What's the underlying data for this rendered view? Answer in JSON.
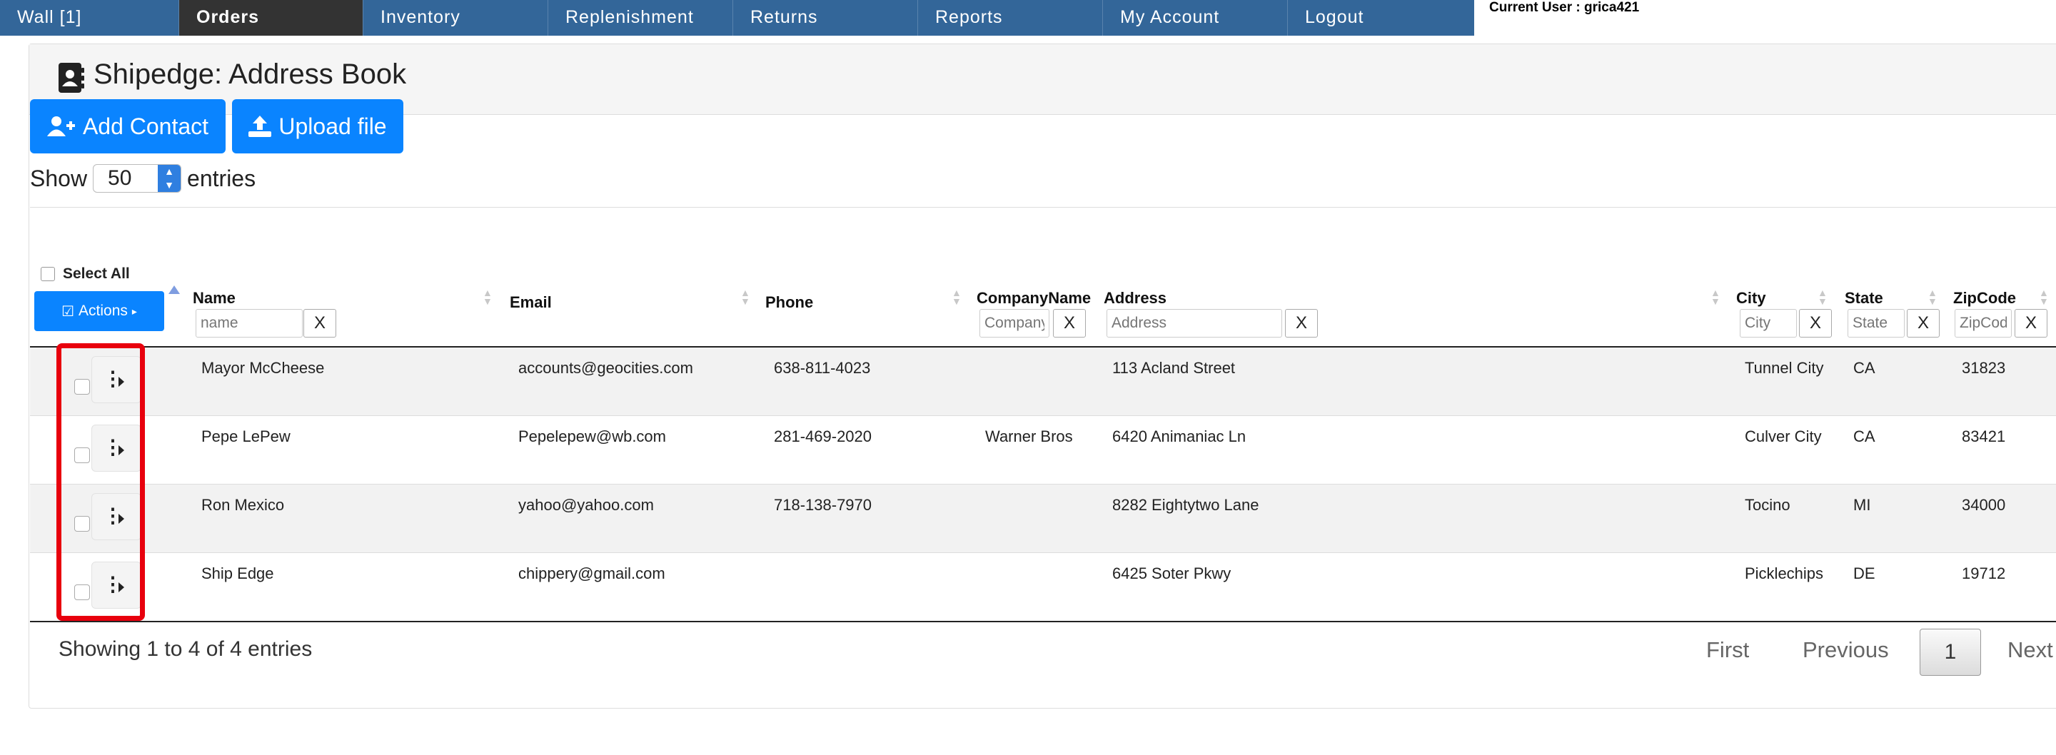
{
  "nav": {
    "items": [
      "Wall [1]",
      "Orders",
      "Inventory",
      "Replenishment",
      "Returns",
      "Reports",
      "My Account",
      "Logout"
    ],
    "active_index": 1,
    "current_user": "Current User : grica421"
  },
  "page": {
    "title": "Shipedge: Address Book",
    "title_icon": "address-book-icon"
  },
  "toolbar": {
    "add_contact_label": "Add Contact",
    "upload_file_label": "Upload file",
    "add_contact_icon": "user-plus-icon",
    "upload_icon": "upload-icon"
  },
  "length_control": {
    "show_label": "Show",
    "value": "50",
    "entries_label": "entries"
  },
  "table": {
    "select_all_label": "Select All",
    "actions_label": "Actions",
    "columns": {
      "name": "Name",
      "email": "Email",
      "phone": "Phone",
      "company": "CompanyName",
      "address": "Address",
      "city": "City",
      "state": "State",
      "zip": "ZipCode"
    },
    "filter_placeholders": {
      "name": "name",
      "company": "Company",
      "address": "Address",
      "city": "City",
      "state": "State",
      "zip": "ZipCode"
    },
    "filter_clear_label": "X",
    "rows": [
      {
        "name": "Mayor McCheese",
        "email": "accounts@geocities.com",
        "phone": "638-811-4023",
        "company": "",
        "address": "113 Acland Street",
        "city": "Tunnel City",
        "state": "CA",
        "zip": "31823"
      },
      {
        "name": "Pepe LePew",
        "email": "Pepelepew@wb.com",
        "phone": "281-469-2020",
        "company": "Warner Bros",
        "address": "6420 Animaniac Ln",
        "city": "Culver City",
        "state": "CA",
        "zip": "83421"
      },
      {
        "name": "Ron Mexico",
        "email": "yahoo@yahoo.com",
        "phone": "718-138-7970",
        "company": "",
        "address": "8282 Eightytwo Lane",
        "city": "Tocino",
        "state": "MI",
        "zip": "34000"
      },
      {
        "name": "Ship Edge",
        "email": "chippery@gmail.com",
        "phone": "",
        "company": "",
        "address": "6425 Soter Pkwy",
        "city": "Picklechips",
        "state": "DE",
        "zip": "19712"
      }
    ]
  },
  "footer": {
    "info": "Showing 1 to 4 of 4 entries",
    "first": "First",
    "previous": "Previous",
    "current_page": "1",
    "next": "Next"
  },
  "colors": {
    "nav_bg": "#336699",
    "nav_active": "#333333",
    "button_blue": "#0a84ff",
    "highlight": "#e8000d"
  }
}
